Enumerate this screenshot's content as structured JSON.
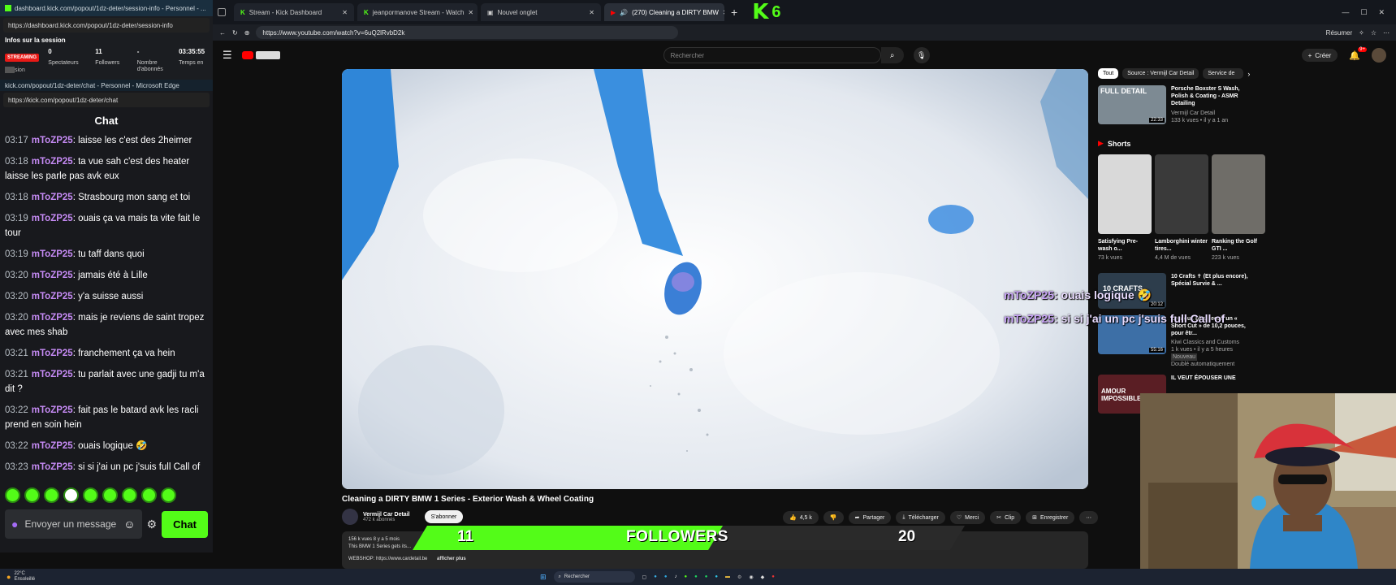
{
  "dashboard": {
    "window_title": "dashboard.kick.com/popout/1dz-deter/session-info - Personnel - ...",
    "url": "https://dashboard.kick.com/popout/1dz-deter/session-info",
    "section_title": "Infos sur la session",
    "badge": "STREAMING",
    "stats": [
      {
        "value": "0",
        "label": "Spectateurs"
      },
      {
        "value": "11",
        "label": "Followers"
      },
      {
        "value": "-",
        "label": "Nombre d'abonnés"
      },
      {
        "value": "03:35:55",
        "label": "Temps en"
      }
    ],
    "session_label": "sion"
  },
  "chat_window": {
    "window_title": "kick.com/popout/1dz-deter/chat - Personnel - Microsoft Edge",
    "url": "https://kick.com/popout/1dz-deter/chat",
    "title": "Chat",
    "messages": [
      {
        "time": "03:17",
        "user": "mToZP25",
        "text": "laisse les c'est des 2heimer"
      },
      {
        "time": "03:18",
        "user": "mToZP25",
        "text": "ta vue sah c'est des heater laisse les parle pas avk eux"
      },
      {
        "time": "03:18",
        "user": "mToZP25",
        "text": "Strasbourg mon sang et toi"
      },
      {
        "time": "03:19",
        "user": "mToZP25",
        "text": "ouais ça va mais ta vite fait le tour"
      },
      {
        "time": "03:19",
        "user": "mToZP25",
        "text": "tu taff dans quoi"
      },
      {
        "time": "03:20",
        "user": "mToZP25",
        "text": "jamais été à Lille"
      },
      {
        "time": "03:20",
        "user": "mToZP25",
        "text": "y'a suisse aussi"
      },
      {
        "time": "03:20",
        "user": "mToZP25",
        "text": "mais je reviens de saint tropez avec mes shab"
      },
      {
        "time": "03:21",
        "user": "mToZP25",
        "text": "franchement ça va hein"
      },
      {
        "time": "03:21",
        "user": "mToZP25",
        "text": "tu parlait avec une gadji tu m'a dit ?"
      },
      {
        "time": "03:22",
        "user": "mToZP25",
        "text": "fait pas le batard avk les racli prend en soin hein"
      },
      {
        "time": "03:22",
        "user": "mToZP25",
        "text": "ouais logique 🤣"
      },
      {
        "time": "03:23",
        "user": "mToZP25",
        "text": "si si j'ai un pc j'suis full Call of"
      }
    ],
    "input_placeholder": "Envoyer un message",
    "send_label": "Chat"
  },
  "browser": {
    "tabs": [
      {
        "label": "Stream - Kick Dashboard"
      },
      {
        "label": "jeanpormanove Stream - Watch"
      },
      {
        "label": "Nouvel onglet"
      },
      {
        "label": "(270) Cleaning a DIRTY BMW"
      }
    ],
    "url": "https://www.youtube.com/watch?v=6uQ2lRvbD2k",
    "resume_label": "Résumer"
  },
  "youtube": {
    "search_placeholder": "Rechercher",
    "create_label": "Créer",
    "notif_count": "9+",
    "video_title": "Cleaning a DIRTY BMW 1 Series - Exterior Wash & Wheel Coating",
    "channel": "Vermijl Car Detail",
    "subscribers": "472 k abonnés",
    "subscribe_label": "S'abonner",
    "likes": "4,5 k",
    "actions": [
      "Partager",
      "Télécharger",
      "Merci",
      "Clip",
      "Enregistrer"
    ],
    "meta": "156 k vues  8 y a 5 mois",
    "desc": "This BMW 1 Series gets its...",
    "desc2": "WEBSHOP: https://www.cardetail.be",
    "more_label": "afficher plus",
    "chips": [
      "Tout",
      "Source : Vermijl Car Detail",
      "Service de"
    ],
    "top_rec": {
      "title": "Porsche Boxster S Wash, Polish & Coating - ASMR Detailing",
      "channel": "Vermijl Car Detail",
      "meta": "133 k vues • il y a 1 an",
      "duration": "22:33",
      "thumb_text": "FULL DETAIL"
    },
    "shorts_title": "Shorts",
    "shorts": [
      {
        "title": "Satisfying Pre-wash o...",
        "views": "73 k vues"
      },
      {
        "title": "Lamborghini winter tires...",
        "views": "4,4 M de vues"
      },
      {
        "title": "Ranking the Golf GTI ...",
        "views": "223 k vues"
      }
    ],
    "recs": [
      {
        "title": "10 Crafts ✝ (Et plus encore), Spécial Survie & ...",
        "channel": "",
        "meta": "",
        "duration": "20:12",
        "thumb_text": "10 CRAFTS"
      },
      {
        "title": "Le vieux bleu reçoit un « Short Cut » de 10,2 pouces, pour êtr...",
        "channel": "Kiwi Classics and Customs",
        "meta": "1 k vues • il y a 5 heures",
        "extra": "Nouveau",
        "extra2": "Doublé automatiquement",
        "duration": "55:16",
        "thumb_text": ""
      },
      {
        "title": "IL VEUT ÉPOUSER UNE",
        "channel": "",
        "meta": "",
        "duration": "",
        "thumb_text": "AMOUR IMPOSSIBLE"
      }
    ]
  },
  "overlay": {
    "messages": [
      {
        "user": "mToZP25",
        "text": ": ouais logique 🤣"
      },
      {
        "user": "mToZP25",
        "text": ": si si j'ai un pc j'suis full Call of"
      }
    ],
    "followers_banner": {
      "current": "11",
      "label": "FOLLOWERS",
      "goal": "20"
    },
    "logo_letter": "K",
    "logo_number": "6",
    "goal_progress": 0.55
  },
  "taskbar": {
    "weather_temp": "22°C",
    "weather_desc": "Ensoleillé",
    "search_placeholder": "Rechercher"
  },
  "colors": {
    "kick_green": "#53fc18",
    "username": "#c68bf5",
    "yt_red": "#ff0000"
  }
}
